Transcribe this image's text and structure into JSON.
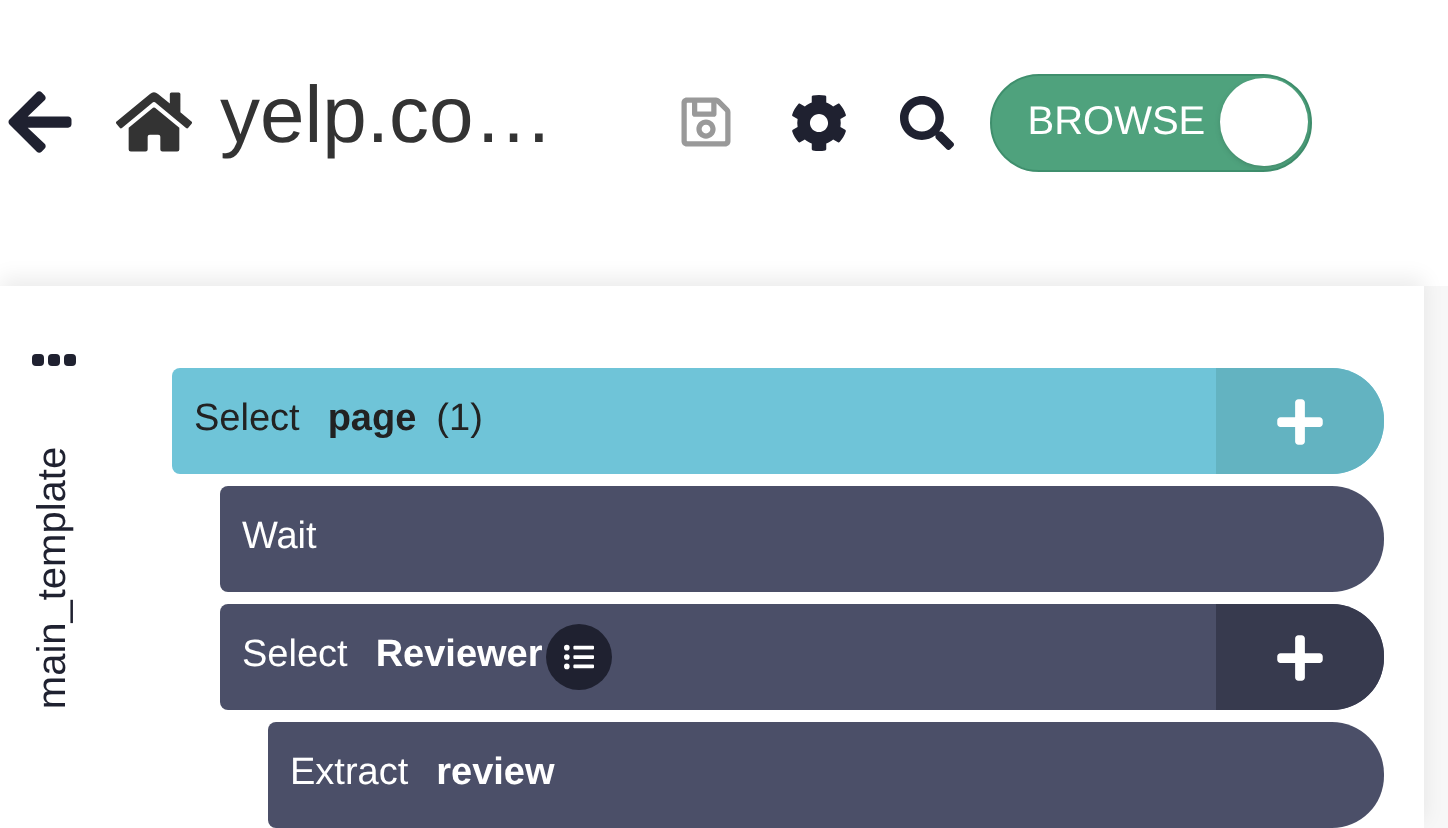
{
  "header": {
    "title": "yelp.co…",
    "save_disabled": true,
    "mode_toggle": {
      "label": "BROWSE",
      "on": true
    }
  },
  "sidebar": {
    "template_name": "main_template"
  },
  "steps": [
    {
      "verb": "Select",
      "target": "page",
      "count": "(1)",
      "selected": true,
      "list_icon": false,
      "add_button": true,
      "children": [
        {
          "verb": "Wait",
          "selected": false,
          "list_icon": false,
          "add_button": false
        },
        {
          "verb": "Select",
          "target": "Reviewer",
          "selected": false,
          "list_icon": true,
          "add_button": true,
          "children": [
            {
              "verb": "Extract",
              "target": "review",
              "selected": false,
              "list_icon": false,
              "add_button": false
            }
          ]
        }
      ]
    }
  ]
}
